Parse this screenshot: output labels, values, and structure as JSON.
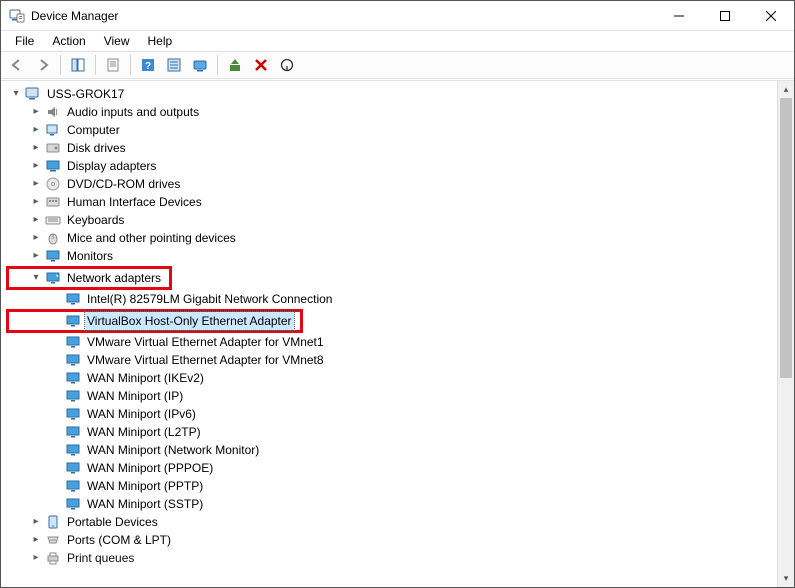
{
  "window": {
    "title": "Device Manager"
  },
  "menus": {
    "file": "File",
    "action": "Action",
    "view": "View",
    "help": "Help"
  },
  "tree": {
    "root": "USS-GROK17",
    "audio": "Audio inputs and outputs",
    "computer": "Computer",
    "disk": "Disk drives",
    "display": "Display adapters",
    "dvd": "DVD/CD-ROM drives",
    "hid": "Human Interface Devices",
    "keyboards": "Keyboards",
    "mice": "Mice and other pointing devices",
    "monitors": "Monitors",
    "net": "Network adapters",
    "net_items": {
      "intel": "Intel(R) 82579LM Gigabit Network Connection",
      "vbox": "VirtualBox Host-Only Ethernet Adapter",
      "vmnet1": "VMware Virtual Ethernet Adapter for VMnet1",
      "vmnet8": "VMware Virtual Ethernet Adapter for VMnet8",
      "ikev2": "WAN Miniport (IKEv2)",
      "ip": "WAN Miniport (IP)",
      "ipv6": "WAN Miniport (IPv6)",
      "l2tp": "WAN Miniport (L2TP)",
      "netmon": "WAN Miniport (Network Monitor)",
      "pppoe": "WAN Miniport (PPPOE)",
      "pptp": "WAN Miniport (PPTP)",
      "sstp": "WAN Miniport (SSTP)"
    },
    "portable": "Portable Devices",
    "ports": "Ports (COM & LPT)",
    "printq": "Print queues"
  }
}
